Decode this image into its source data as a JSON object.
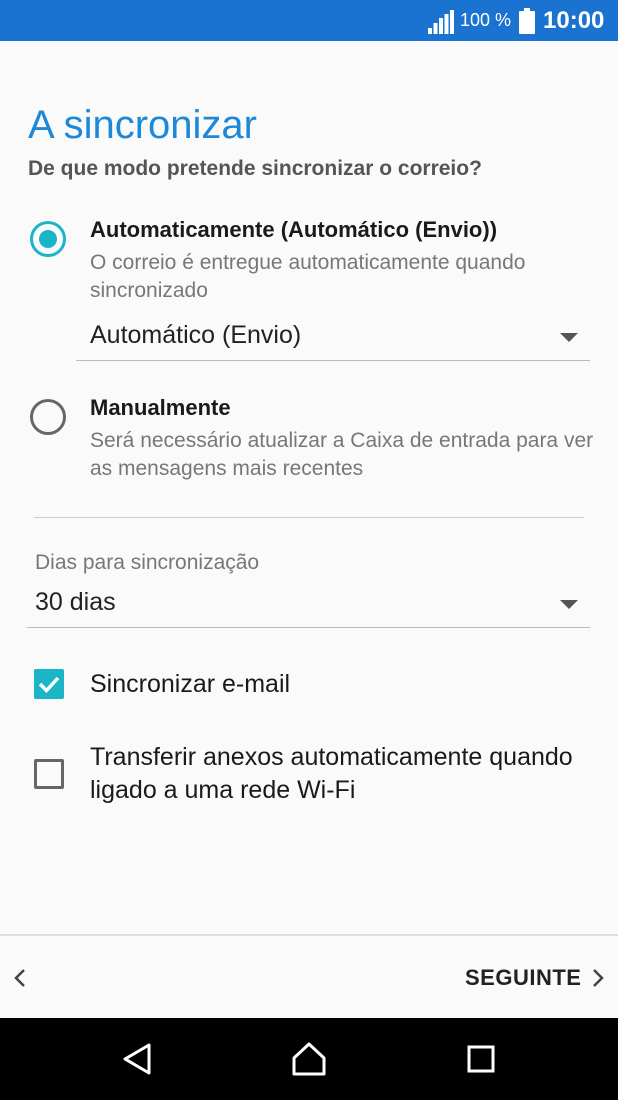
{
  "status_bar": {
    "battery_percent": "100 %",
    "time": "10:00",
    "icons": [
      "signal-icon",
      "battery-icon"
    ]
  },
  "page": {
    "title": "A sincronizar",
    "subtitle": "De que modo pretende sincronizar o correio?"
  },
  "sync_options": [
    {
      "title": "Automaticamente (Automático (Envio))",
      "description": "O correio é entregue automaticamente quando sincronizado",
      "selected": true
    },
    {
      "title": "Manualmente",
      "description": "Será necessário atualizar a Caixa de entrada para ver as mensagens mais recentes",
      "selected": false
    }
  ],
  "auto_mode_dropdown": {
    "value": "Automático (Envio)"
  },
  "sync_days": {
    "label": "Dias para sincronização",
    "value": "30 dias"
  },
  "checkboxes": [
    {
      "label": "Sincronizar e-mail",
      "checked": true
    },
    {
      "label": "Transferir anexos automaticamente quando ligado a uma rede Wi-Fi",
      "checked": false
    }
  ],
  "bottom_bar": {
    "next_label": "SEGUINTE"
  },
  "colors": {
    "status_bar": "#1a73d1",
    "title": "#1e88d8",
    "accent": "#1ab6c8"
  }
}
